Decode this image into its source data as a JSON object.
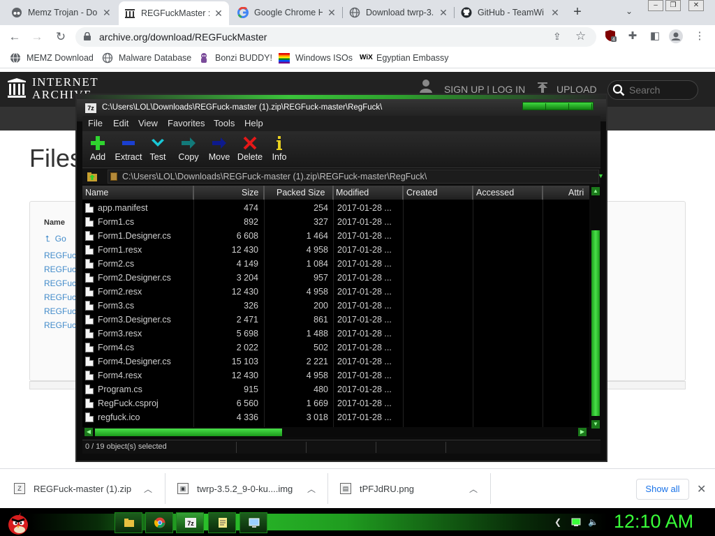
{
  "browser": {
    "tabs": [
      {
        "title": "Memz Trojan - Do",
        "icon": "incognito-icon"
      },
      {
        "title": "REGFuckMaster : ",
        "icon": "archive-icon",
        "active": true
      },
      {
        "title": "Google Chrome H",
        "icon": "google-icon"
      },
      {
        "title": "Download twrp-3.",
        "icon": "globe-icon"
      },
      {
        "title": "GitHub - TeamWi",
        "icon": "github-icon"
      }
    ],
    "url": "archive.org/download/REGFuckMaster",
    "extension_badge": "4",
    "bookmarks": [
      "MEMZ Download",
      "Malware Database",
      "Bonzi BUDDY!",
      "Windows ISOs",
      "Egyptian Embassy"
    ]
  },
  "ia": {
    "logo_line1": "INTERNET",
    "logo_line2": "ARCHIVE",
    "signup": "SIGN UP | LOG IN",
    "upload": "UPLOAD",
    "search_placeholder": "Search",
    "page_title": "Files",
    "column_name": "Name",
    "go_up": "Go",
    "file_links": [
      "REGFuc",
      "REGFuc",
      "REGFuc",
      "REGFuc",
      "REGFuc",
      "REGFuc"
    ]
  },
  "sevenzip": {
    "title": "C:\\Users\\LOL\\Downloads\\REGFuck-master (1).zip\\REGFuck-master\\RegFuck\\",
    "menu": [
      "File",
      "Edit",
      "View",
      "Favorites",
      "Tools",
      "Help"
    ],
    "toolbar": [
      "Add",
      "Extract",
      "Test",
      "Copy",
      "Move",
      "Delete",
      "Info"
    ],
    "path": "C:\\Users\\LOL\\Downloads\\REGFuck-master (1).zip\\REGFuck-master\\RegFuck\\",
    "columns": [
      "Name",
      "Size",
      "Packed Size",
      "Modified",
      "Created",
      "Accessed",
      "Attri"
    ],
    "files": [
      {
        "name": "app.manifest",
        "size": "474",
        "packed": "254",
        "modified": "2017-01-28 ..."
      },
      {
        "name": "Form1.cs",
        "size": "892",
        "packed": "327",
        "modified": "2017-01-28 ..."
      },
      {
        "name": "Form1.Designer.cs",
        "size": "6 608",
        "packed": "1 464",
        "modified": "2017-01-28 ..."
      },
      {
        "name": "Form1.resx",
        "size": "12 430",
        "packed": "4 958",
        "modified": "2017-01-28 ..."
      },
      {
        "name": "Form2.cs",
        "size": "4 149",
        "packed": "1 084",
        "modified": "2017-01-28 ..."
      },
      {
        "name": "Form2.Designer.cs",
        "size": "3 204",
        "packed": "957",
        "modified": "2017-01-28 ..."
      },
      {
        "name": "Form2.resx",
        "size": "12 430",
        "packed": "4 958",
        "modified": "2017-01-28 ..."
      },
      {
        "name": "Form3.cs",
        "size": "326",
        "packed": "200",
        "modified": "2017-01-28 ..."
      },
      {
        "name": "Form3.Designer.cs",
        "size": "2 471",
        "packed": "861",
        "modified": "2017-01-28 ..."
      },
      {
        "name": "Form3.resx",
        "size": "5 698",
        "packed": "1 488",
        "modified": "2017-01-28 ..."
      },
      {
        "name": "Form4.cs",
        "size": "2 022",
        "packed": "502",
        "modified": "2017-01-28 ..."
      },
      {
        "name": "Form4.Designer.cs",
        "size": "15 103",
        "packed": "2 221",
        "modified": "2017-01-28 ..."
      },
      {
        "name": "Form4.resx",
        "size": "12 430",
        "packed": "4 958",
        "modified": "2017-01-28 ..."
      },
      {
        "name": "Program.cs",
        "size": "915",
        "packed": "480",
        "modified": "2017-01-28 ..."
      },
      {
        "name": "RegFuck.csproj",
        "size": "6 560",
        "packed": "1 669",
        "modified": "2017-01-28 ..."
      },
      {
        "name": "regfuck.ico",
        "size": "4 336",
        "packed": "3 018",
        "modified": "2017-01-28 ..."
      }
    ],
    "status": "0 / 19 object(s) selected",
    "accent": "#3fd83f"
  },
  "downloads": {
    "items": [
      {
        "name": "REGFuck-master (1).zip",
        "icon": "zip-file-icon"
      },
      {
        "name": "twrp-3.5.2_9-0-ku....img",
        "icon": "disk-image-icon"
      },
      {
        "name": "tPFJdRU.png",
        "icon": "image-file-icon"
      }
    ],
    "show_all": "Show all"
  },
  "taskbar": {
    "clock": "12:10 AM",
    "apps": [
      "file-explorer-icon",
      "chrome-icon",
      "7zip-icon",
      "notepad-icon",
      "monitor-icon"
    ]
  }
}
